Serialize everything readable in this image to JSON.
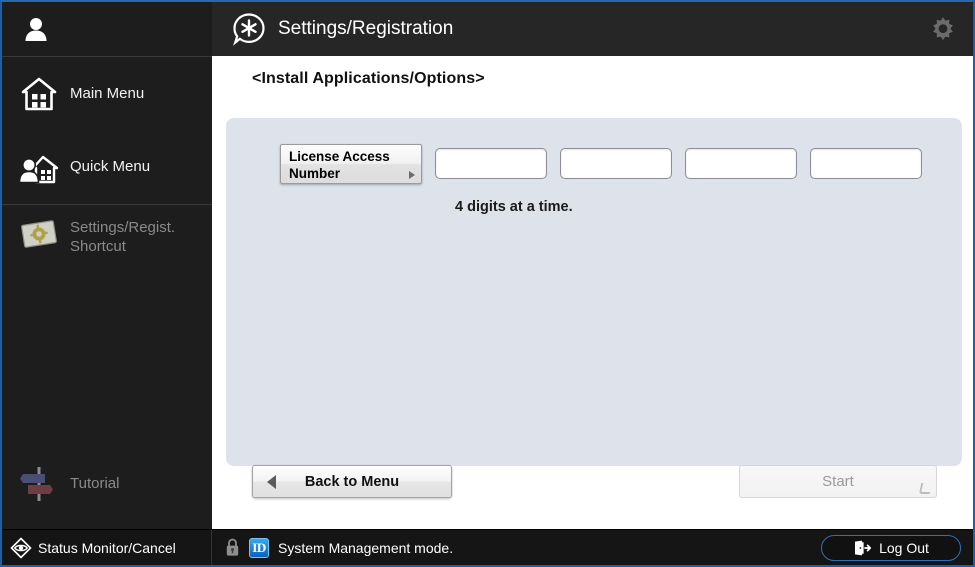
{
  "app": {
    "header_title": "Settings/Registration",
    "header_icon": "settings-registration-icon",
    "gear_icon": "gear-icon"
  },
  "sidebar": {
    "avatar_icon": "user-avatar-icon",
    "items": [
      {
        "label": "Main Menu",
        "icon": "home-icon",
        "enabled": true
      },
      {
        "label": "Quick Menu",
        "icon": "person-home-icon",
        "enabled": true
      },
      {
        "label": "Settings/Regist.\nShortcut",
        "label_line1": "Settings/Regist.",
        "label_line2": "Shortcut",
        "icon": "settings-shortcut-card-icon",
        "enabled": false
      },
      {
        "label": "Tutorial",
        "icon": "signpost-icon",
        "enabled": false
      }
    ]
  },
  "main": {
    "breadcrumb": "<Install Applications/Options>",
    "license_button_line1": "License Access",
    "license_button_line2": "Number",
    "license_button_arrow_icon": "right-triangle-icon",
    "digit_fields": [
      {
        "name": "digit-field-1",
        "value": "",
        "placeholder": ""
      },
      {
        "name": "digit-field-2",
        "value": "",
        "placeholder": ""
      },
      {
        "name": "digit-field-3",
        "value": "",
        "placeholder": ""
      },
      {
        "name": "digit-field-4",
        "value": "",
        "placeholder": ""
      }
    ],
    "hint": "4 digits at a time."
  },
  "footer_buttons": {
    "back_label": "Back to Menu",
    "back_icon": "left-triangle-icon",
    "start_label": "Start",
    "start_enabled": false
  },
  "statusbar": {
    "status_monitor_label": "Status Monitor/Cancel",
    "status_monitor_icon": "diamond-eye-icon",
    "lock_icon": "padlock-icon",
    "id_badge": "ID",
    "system_mode": "System Management mode.",
    "logout_label": "Log Out",
    "logout_icon": "exit-door-icon"
  },
  "colors": {
    "screen_border": "#1f5fa8",
    "sidebar_bg": "#1d1d1d",
    "titlebar_bg": "#262626",
    "panel_bg": "#dee2ea",
    "statusbar_bg": "#151515",
    "id_badge_blue": "#0a63b6",
    "logout_border": "#2f6fb5"
  }
}
